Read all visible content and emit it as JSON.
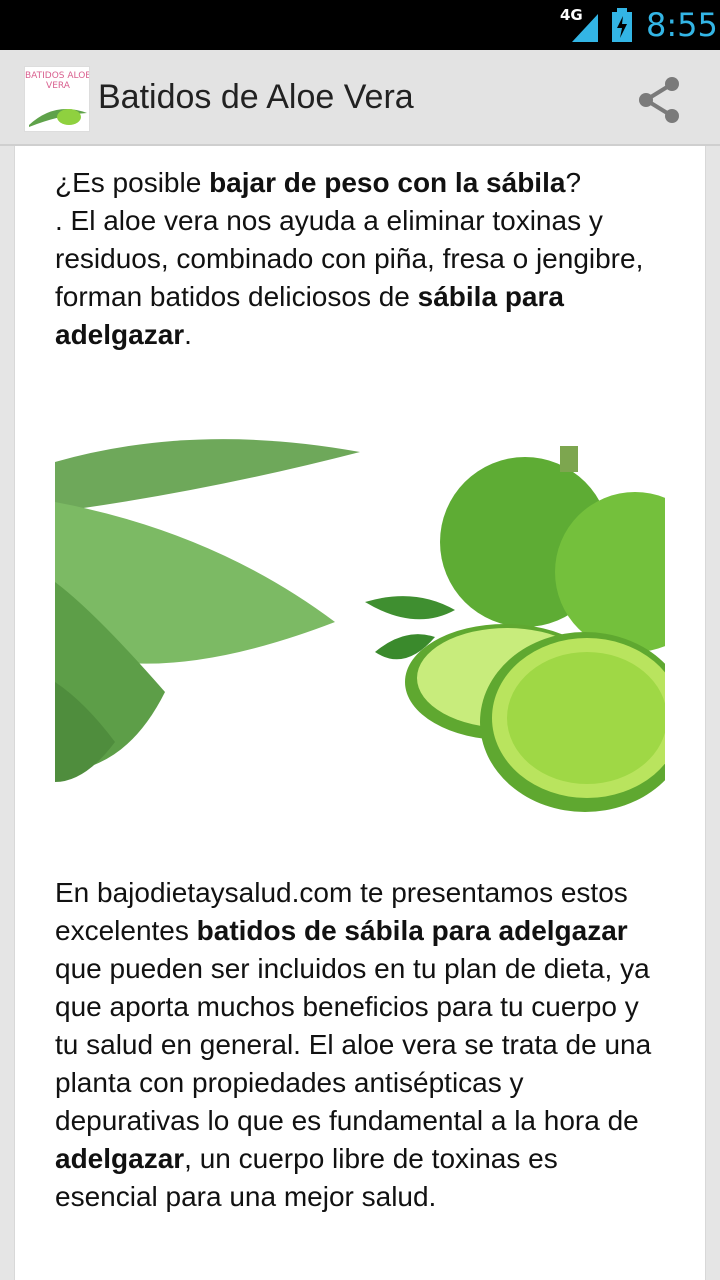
{
  "status_bar": {
    "network": "4G",
    "time": "8:55",
    "signal_icon": "signal-icon",
    "battery_icon": "battery-charging-icon"
  },
  "action_bar": {
    "app_icon_text": "BATIDOS ALOE VERA",
    "title": "Batidos de Aloe Vera",
    "share_icon": "share-icon"
  },
  "article": {
    "p1": {
      "t1": "¿Es posible ",
      "b1": "bajar de peso con la sábila",
      "t2": "?",
      "t3": ". El aloe vera nos ayuda a eliminar toxinas y residuos, combinado con piña, fresa o jengibre, forman batidos deliciosos de ",
      "b2": "sábila para adelgazar",
      "t4": "."
    },
    "image_subject": "aloe vera leaves and limes",
    "p2": {
      "t1": "En bajodietaysalud.com te presentamos estos excelentes ",
      "b1": "batidos de sábila para adelgazar",
      "t2": " que  pueden ser incluidos en tu plan de dieta, ya que aporta muchos beneficios para tu cuerpo y tu salud en general. El aloe vera se trata de una planta con propiedades antisépticas y depurativas lo que es fundamental a la hora de ",
      "b2": "adelgazar",
      "t3": ", un cuerpo libre de toxinas  es esencial para una mejor salud."
    }
  },
  "colors": {
    "status_bar_bg": "#000000",
    "clock": "#33b5e5",
    "action_bar_bg": "#e3e3e3",
    "aloe_green": "#5fa24a",
    "lime_green": "#8fd13f"
  }
}
